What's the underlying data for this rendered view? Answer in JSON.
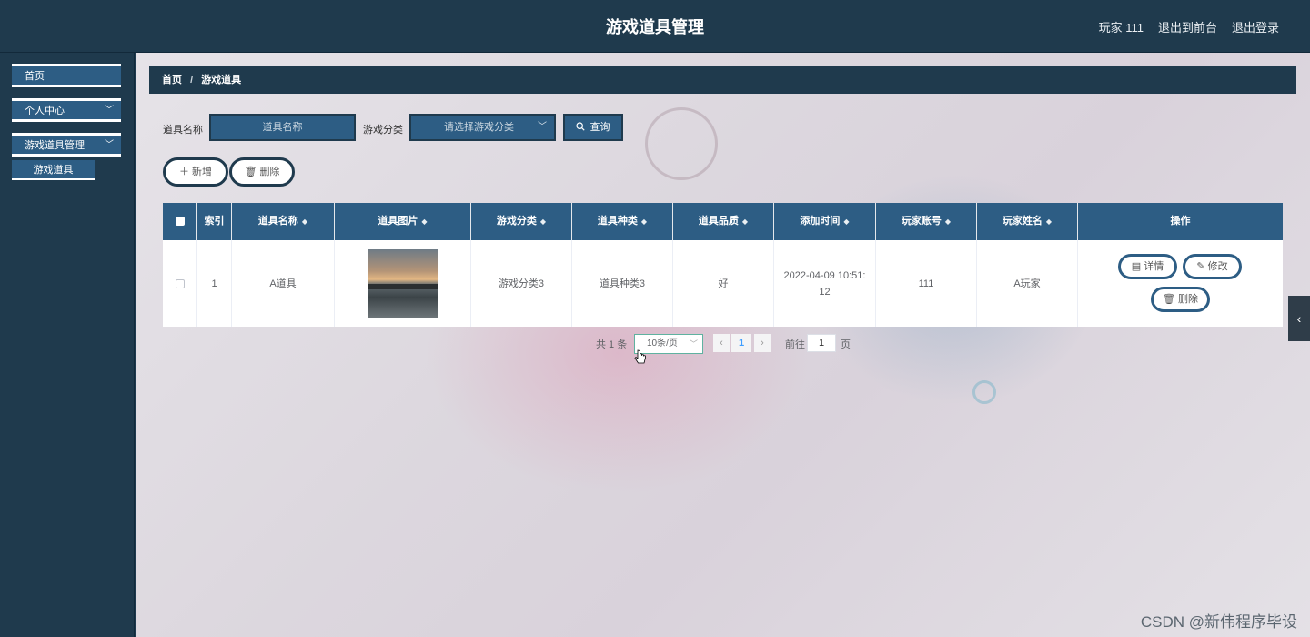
{
  "header": {
    "title": "游戏道具管理",
    "user_label": "玩家 111",
    "to_front_label": "退出到前台",
    "logout_label": "退出登录"
  },
  "sidebar": {
    "items": [
      {
        "label": "首页"
      },
      {
        "label": "个人中心"
      },
      {
        "label": "游戏道具管理"
      }
    ],
    "sub_item": "游戏道具"
  },
  "breadcrumb": {
    "home": "首页",
    "sep": "/",
    "current": "游戏道具"
  },
  "search": {
    "name_label": "道具名称",
    "name_placeholder": "道具名称",
    "category_label": "游戏分类",
    "category_placeholder": "请选择游戏分类",
    "query_label": "查询"
  },
  "actions": {
    "add_label": "新增",
    "delete_label": "删除"
  },
  "table": {
    "columns": [
      "索引",
      "道具名称",
      "道具图片",
      "游戏分类",
      "道具种类",
      "道具品质",
      "添加时间",
      "玩家账号",
      "玩家姓名",
      "操作"
    ],
    "rows": [
      {
        "index": "1",
        "name": "A道具",
        "category": "游戏分类3",
        "kind": "道具种类3",
        "quality": "好",
        "time_line1": "2022-04-09 10:51:",
        "time_line2": "12",
        "account": "111",
        "player": "A玩家"
      }
    ],
    "ops": {
      "detail": "详情",
      "edit": "修改",
      "delete": "删除"
    }
  },
  "pagination": {
    "total": "共 1 条",
    "page_size": "10条/页",
    "current_page": "1",
    "goto_label": "前往",
    "goto_value": "1",
    "page_unit": "页"
  },
  "watermark": "CSDN @新伟程序毕设",
  "colors": {
    "header_bg": "#1f3a4d",
    "accent": "#2d5d84"
  }
}
